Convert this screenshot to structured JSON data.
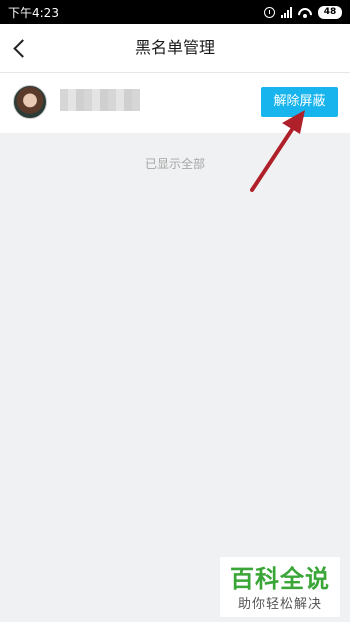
{
  "status_bar": {
    "time": "下午4:23",
    "battery": "48",
    "icons": [
      "alarm-icon",
      "signal-icon",
      "wifi-icon",
      "battery-icon"
    ]
  },
  "header": {
    "title": "黑名单管理",
    "back_icon": "back-chevron-icon"
  },
  "blacklist": {
    "items": [
      {
        "avatar": "avatar-image",
        "name": "",
        "action_label": "解除屏蔽"
      }
    ],
    "footer_text": "已显示全部"
  },
  "colors": {
    "accent": "#17b4ee",
    "annotation_arrow": "#b0202a",
    "background": "#f0f1f2",
    "watermark_green": "#3aa638"
  },
  "watermark": {
    "title": "百科全说",
    "subtitle": "助你轻松解决"
  }
}
